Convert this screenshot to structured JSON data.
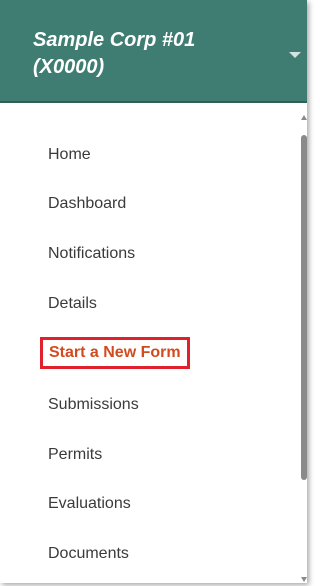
{
  "header": {
    "org_name": "Sample Corp #01 (X0000)",
    "background_color": "#3f7d73"
  },
  "menu": {
    "items": [
      {
        "label": "Home"
      },
      {
        "label": "Dashboard"
      },
      {
        "label": "Notifications"
      },
      {
        "label": "Details"
      },
      {
        "label": "Start a New Form",
        "active": true
      },
      {
        "label": "Submissions"
      },
      {
        "label": "Permits"
      },
      {
        "label": "Evaluations"
      },
      {
        "label": "Documents"
      }
    ],
    "active_color": "#d14b1f",
    "highlight_border_color": "#e0202b"
  }
}
